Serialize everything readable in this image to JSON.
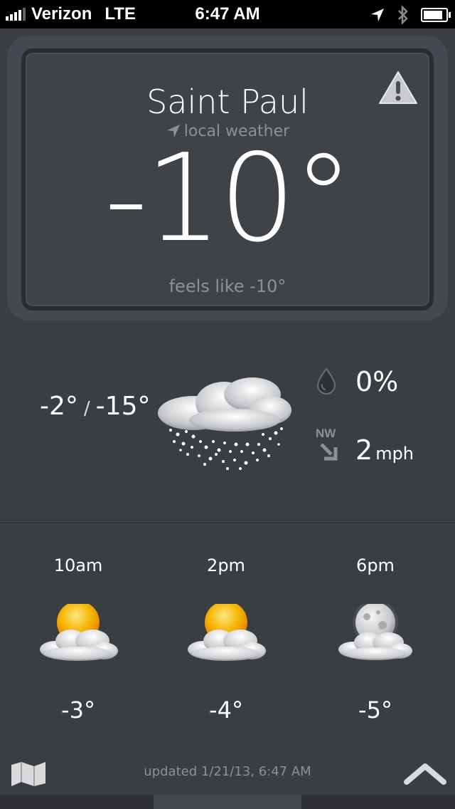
{
  "status_bar": {
    "carrier": "Verizon",
    "network": "LTE",
    "time": "6:47 AM"
  },
  "current": {
    "city": "Saint Paul",
    "subtitle": "local weather",
    "temperature": "-10°",
    "feels_like": "feels like -10°"
  },
  "today": {
    "high": "-2°",
    "separator": "/",
    "low": "-15°",
    "precip_chance": "0%",
    "wind_direction": "NW",
    "wind_speed": "2",
    "wind_unit": "mph"
  },
  "forecast": [
    {
      "time": "10am",
      "temp": "-3°",
      "icon": "partly-cloudy-sun-icon"
    },
    {
      "time": "2pm",
      "temp": "-4°",
      "icon": "partly-cloudy-sun-icon"
    },
    {
      "time": "6pm",
      "temp": "-5°",
      "icon": "partly-cloudy-moon-icon"
    }
  ],
  "footer": {
    "updated": "updated 1/21/13, 6:47 AM"
  },
  "colors": {
    "background": "#3a3d42",
    "sun": "#f5b400",
    "muted_text": "#8d9096"
  }
}
